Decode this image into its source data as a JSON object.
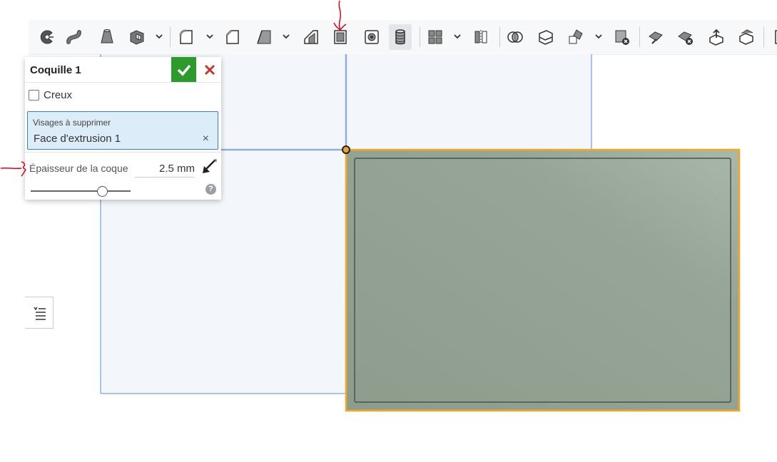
{
  "toolbar": {
    "tools": [
      {
        "name": "revolve-icon"
      },
      {
        "name": "sweep-icon"
      },
      {
        "name": "loft-icon"
      },
      {
        "name": "thicken-icon"
      },
      {
        "name": "fillet-icon"
      },
      {
        "name": "chamfer-icon"
      },
      {
        "name": "draft-icon"
      },
      {
        "name": "rib-icon"
      },
      {
        "name": "shell-icon"
      },
      {
        "name": "hole-icon"
      },
      {
        "name": "thread-icon"
      },
      {
        "name": "pattern-icon"
      },
      {
        "name": "mirror-icon"
      },
      {
        "name": "boolean-icon"
      },
      {
        "name": "split-icon"
      },
      {
        "name": "transform-icon"
      },
      {
        "name": "delete-part-icon"
      },
      {
        "name": "modify-fillet-icon"
      },
      {
        "name": "delete-face-icon"
      },
      {
        "name": "move-face-icon"
      },
      {
        "name": "replace-face-icon"
      }
    ]
  },
  "panel": {
    "title": "Coquille 1",
    "hollow_label": "Creux",
    "hollow_checked": false,
    "faces_label": "Visages à supprimer",
    "faces_value": "Face d'extrusion 1",
    "faces_clear": "×",
    "thickness_label": "Épaisseur de la coque",
    "thickness_value": "2.5 mm",
    "slider_fraction": 0.72,
    "help_symbol": "?"
  },
  "colors": {
    "accent_ok": "#2d9a2d",
    "cancel": "#c0392b",
    "selection_outline": "#f5a623",
    "part_fill": "#96a496",
    "sketch_lines": "#a9c4e4",
    "annotation": "#e0001b"
  }
}
